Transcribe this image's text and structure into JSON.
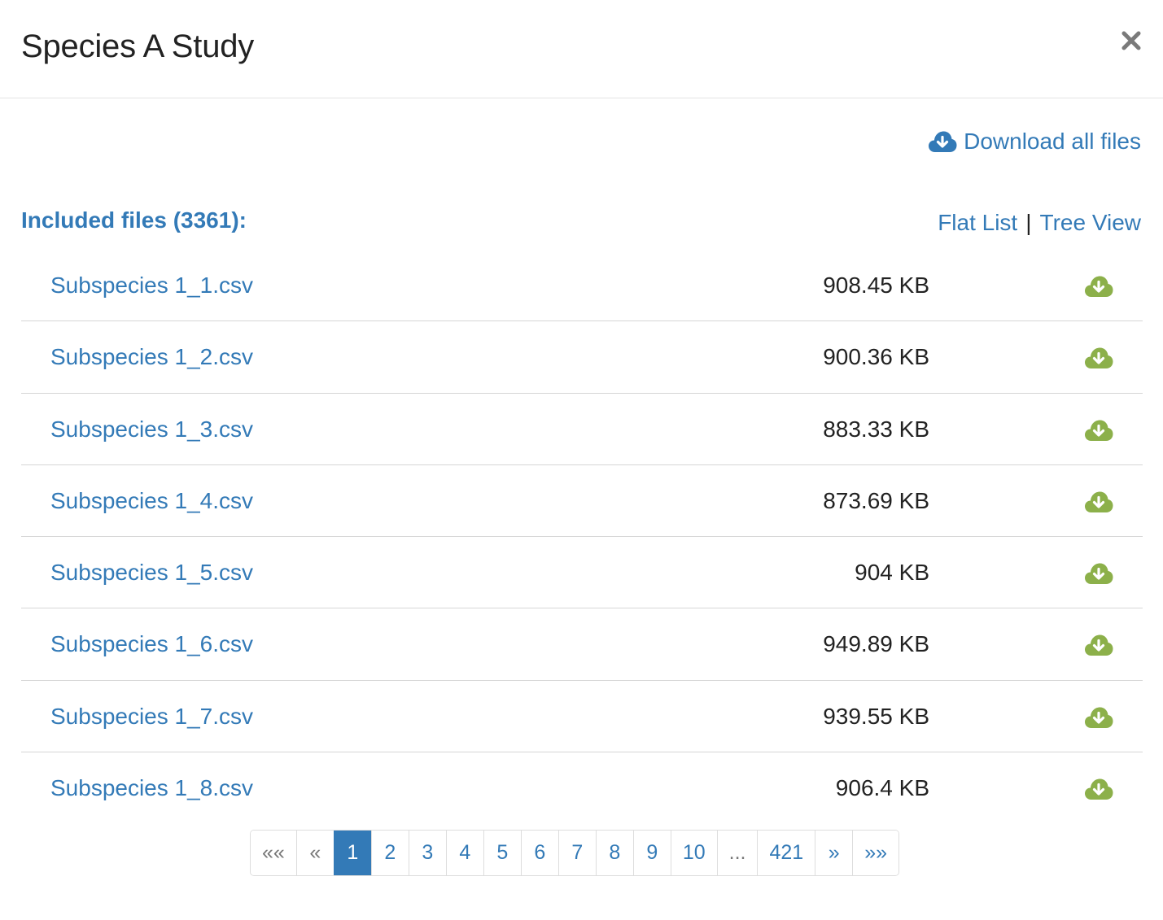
{
  "modal": {
    "title": "Species A Study"
  },
  "actions": {
    "download_all_label": "Download all files"
  },
  "files_section": {
    "heading": "Included files (3361):",
    "view_flat": "Flat List",
    "view_separator": "|",
    "view_tree": "Tree View"
  },
  "files": [
    {
      "name": "Subspecies 1_1.csv",
      "size": "908.45 KB"
    },
    {
      "name": "Subspecies 1_2.csv",
      "size": "900.36 KB"
    },
    {
      "name": "Subspecies 1_3.csv",
      "size": "883.33 KB"
    },
    {
      "name": "Subspecies 1_4.csv",
      "size": "873.69 KB"
    },
    {
      "name": "Subspecies 1_5.csv",
      "size": "904 KB"
    },
    {
      "name": "Subspecies 1_6.csv",
      "size": "949.89 KB"
    },
    {
      "name": "Subspecies 1_7.csv",
      "size": "939.55 KB"
    },
    {
      "name": "Subspecies 1_8.csv",
      "size": "906.4 KB"
    }
  ],
  "pagination": {
    "first": "««",
    "prev": "«",
    "pages": [
      "1",
      "2",
      "3",
      "4",
      "5",
      "6",
      "7",
      "8",
      "9",
      "10"
    ],
    "ellipsis": "...",
    "last_page": "421",
    "next": "»",
    "last": "»»",
    "current": "1"
  },
  "colors": {
    "link": "#337ab7",
    "download_icon": "#8cb04a",
    "close_icon": "#7a7a7a"
  },
  "icons": {
    "close": "close-icon",
    "download_all": "cloud-download-icon",
    "file_download": "cloud-download-icon"
  }
}
